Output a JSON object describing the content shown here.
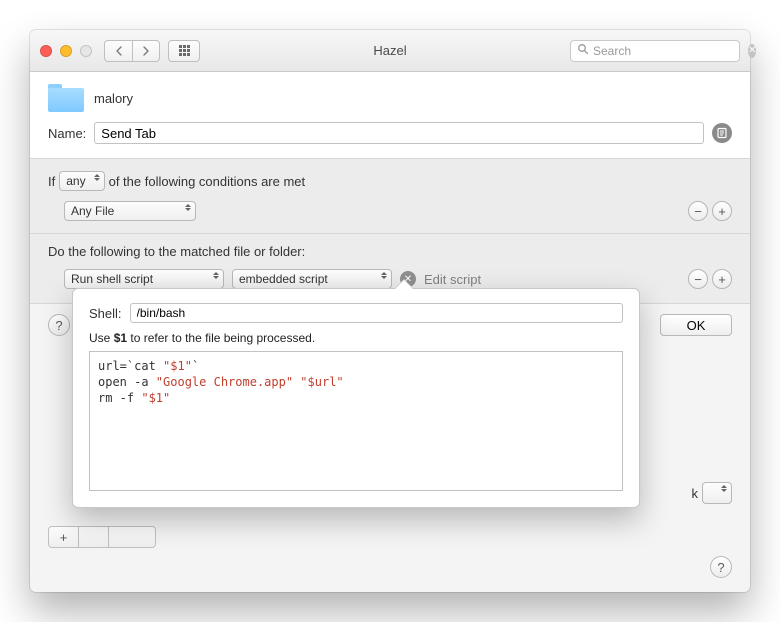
{
  "titlebar": {
    "title": "Hazel",
    "search_placeholder": "Search"
  },
  "header": {
    "folder_name": "malory",
    "name_label": "Name:",
    "name_value": "Send Tab"
  },
  "conditions": {
    "if_prefix": "If",
    "if_mode": "any",
    "if_suffix": "of the following conditions are met",
    "rule0": "Any File"
  },
  "actions": {
    "label": "Do the following to the matched file or folder:",
    "verb": "Run shell script",
    "script_source": "embedded script",
    "edit_link": "Edit script"
  },
  "buttons": {
    "ok": "OK"
  },
  "bottom": {
    "frag_label": "k"
  },
  "popover": {
    "shell_label": "Shell:",
    "shell_value": "/bin/bash",
    "hint_pre": "Use ",
    "hint_var": "$1",
    "hint_post": " to refer to the file being processed.",
    "code_l1a": "url=`cat ",
    "code_l1b": "\"$1\"",
    "code_l1c": "`",
    "code_l2a": "open -a ",
    "code_l2b": "\"Google Chrome.app\" \"$url\"",
    "code_l3a": "rm -f ",
    "code_l3b": "\"$1\""
  }
}
